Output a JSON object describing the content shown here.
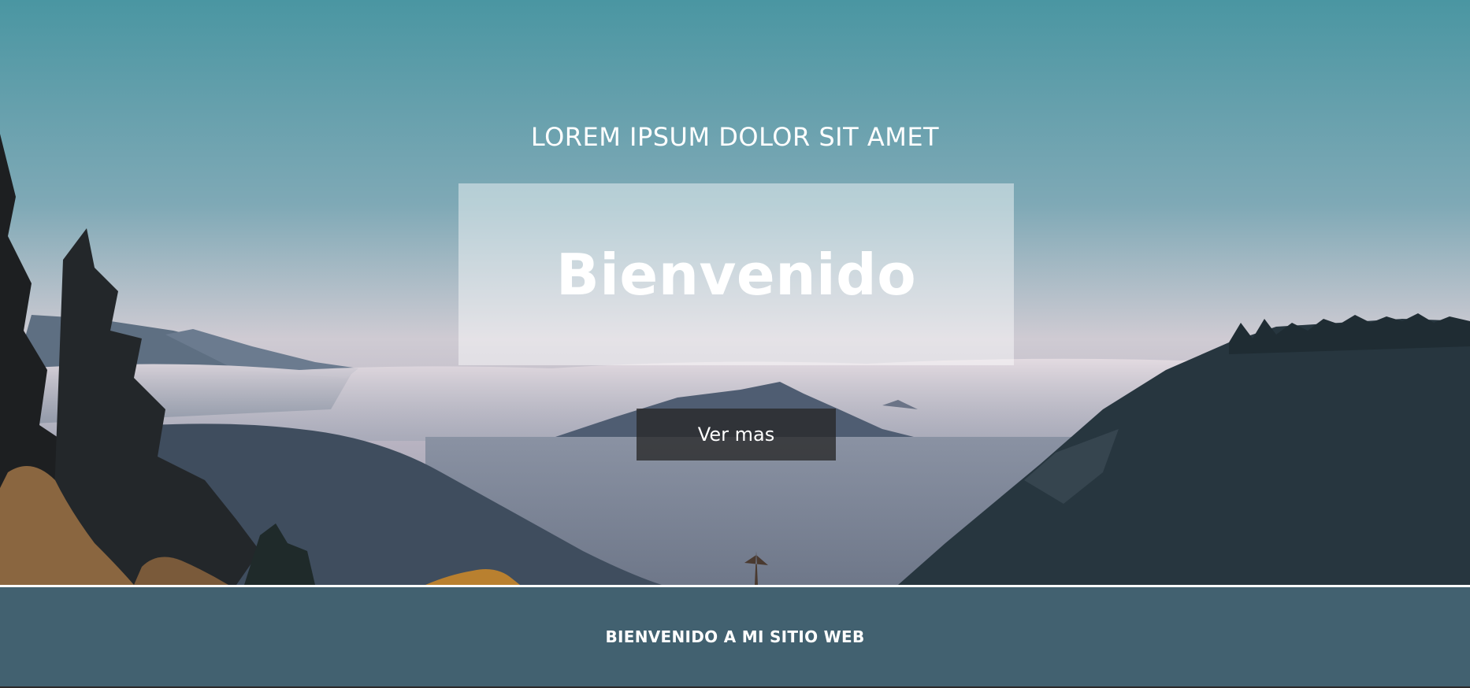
{
  "hero": {
    "subtitle": "LOREM IPSUM DOLOR SIT AMET",
    "title": "Bienvenido",
    "button_label": "Ver mas"
  },
  "section": {
    "heading": "BIENVENIDO A MI SITIO WEB"
  },
  "colors": {
    "sky_top": "#4a96a2",
    "sky_bottom": "#d9c9d1",
    "footer_band": "#426170",
    "button_bg": "#2f2f2f",
    "text": "#ffffff"
  }
}
